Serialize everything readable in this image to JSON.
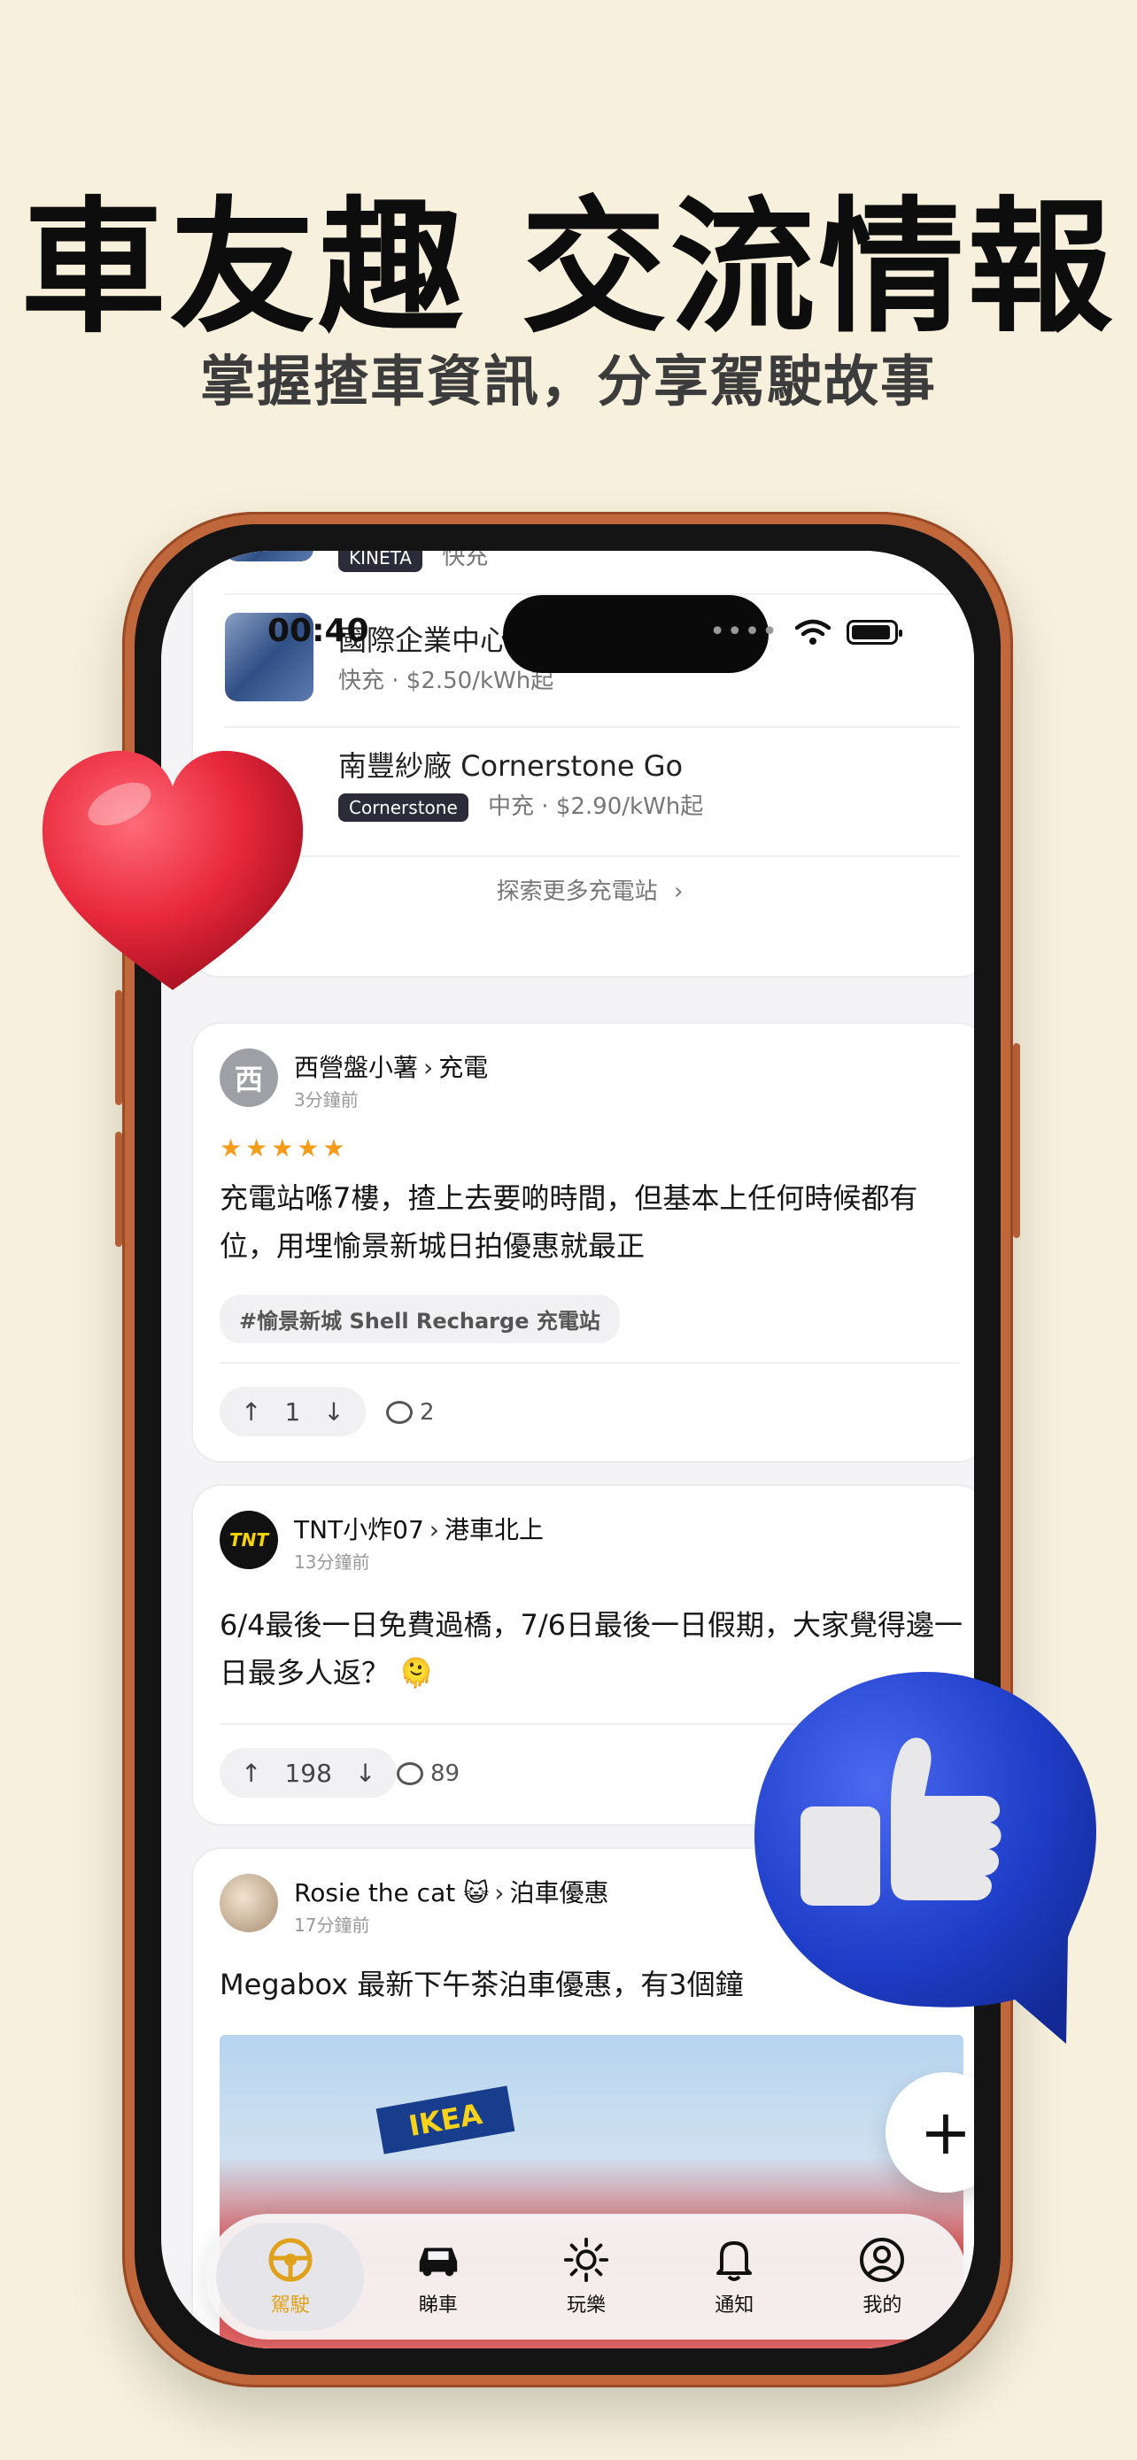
{
  "promo": {
    "headline": "車友趣 交流情報",
    "subheadline": "掌握揸車資訊，分享駕駛故事"
  },
  "status_bar": {
    "time": "00:40"
  },
  "charging_card": {
    "partial_top": {
      "brand": "KINETA",
      "meta": "快充"
    },
    "stations": [
      {
        "title": "國際企業中心三期 Asgard",
        "meta": "快充 · $2.50/kWh起",
        "brand": ""
      },
      {
        "title": "南豐紗廠 Cornerstone Go",
        "meta": "中充 · $2.90/kWh起",
        "brand": "Cornerstone"
      }
    ],
    "explore_label": "探索更多充電站",
    "explore_chevron": "›"
  },
  "posts": [
    {
      "avatar_letter": "西",
      "author": "西營盤小薯",
      "topic": "充電",
      "ago": "3分鐘前",
      "stars": "★★★★★",
      "text": "充電站喺7樓，揸上去要啲時間，但基本上任何時候都有位，用埋愉景新城日拍優惠就最正",
      "tag": "#愉景新城 Shell Recharge 充電站",
      "votes": "1",
      "comments": "2"
    },
    {
      "avatar_letter": "TNT",
      "author": "TNT小炸07",
      "topic": "港車北上",
      "ago": "13分鐘前",
      "text": "6/4最後一日免費過橋，7/6日最後一日假期，大家覺得邊一日最多人返？ 🫠",
      "votes": "198",
      "comments": "89"
    },
    {
      "author": "Rosie the cat 😺",
      "topic": "泊車優惠",
      "ago": "17分鐘前",
      "text": "Megabox 最新下午茶泊車優惠，有3個鐘",
      "photo_sign": "IKEA"
    }
  ],
  "fab": {
    "icon": "plus-icon",
    "label": "+"
  },
  "bottom_nav": [
    {
      "label": "駕駛",
      "icon": "steering-wheel-icon",
      "active": true
    },
    {
      "label": "睇車",
      "icon": "car-icon",
      "active": false
    },
    {
      "label": "玩樂",
      "icon": "sun-icon",
      "active": false
    },
    {
      "label": "通知",
      "icon": "bell-icon",
      "active": false
    },
    {
      "label": "我的",
      "icon": "profile-icon",
      "active": false
    }
  ],
  "colors": {
    "background": "#f7f0dc",
    "phone_frame": "#c0673c",
    "accent": "#e0a11c",
    "star": "#f59b1a",
    "heart": "#e8283c",
    "like_bubble": "#1f3ec9"
  }
}
